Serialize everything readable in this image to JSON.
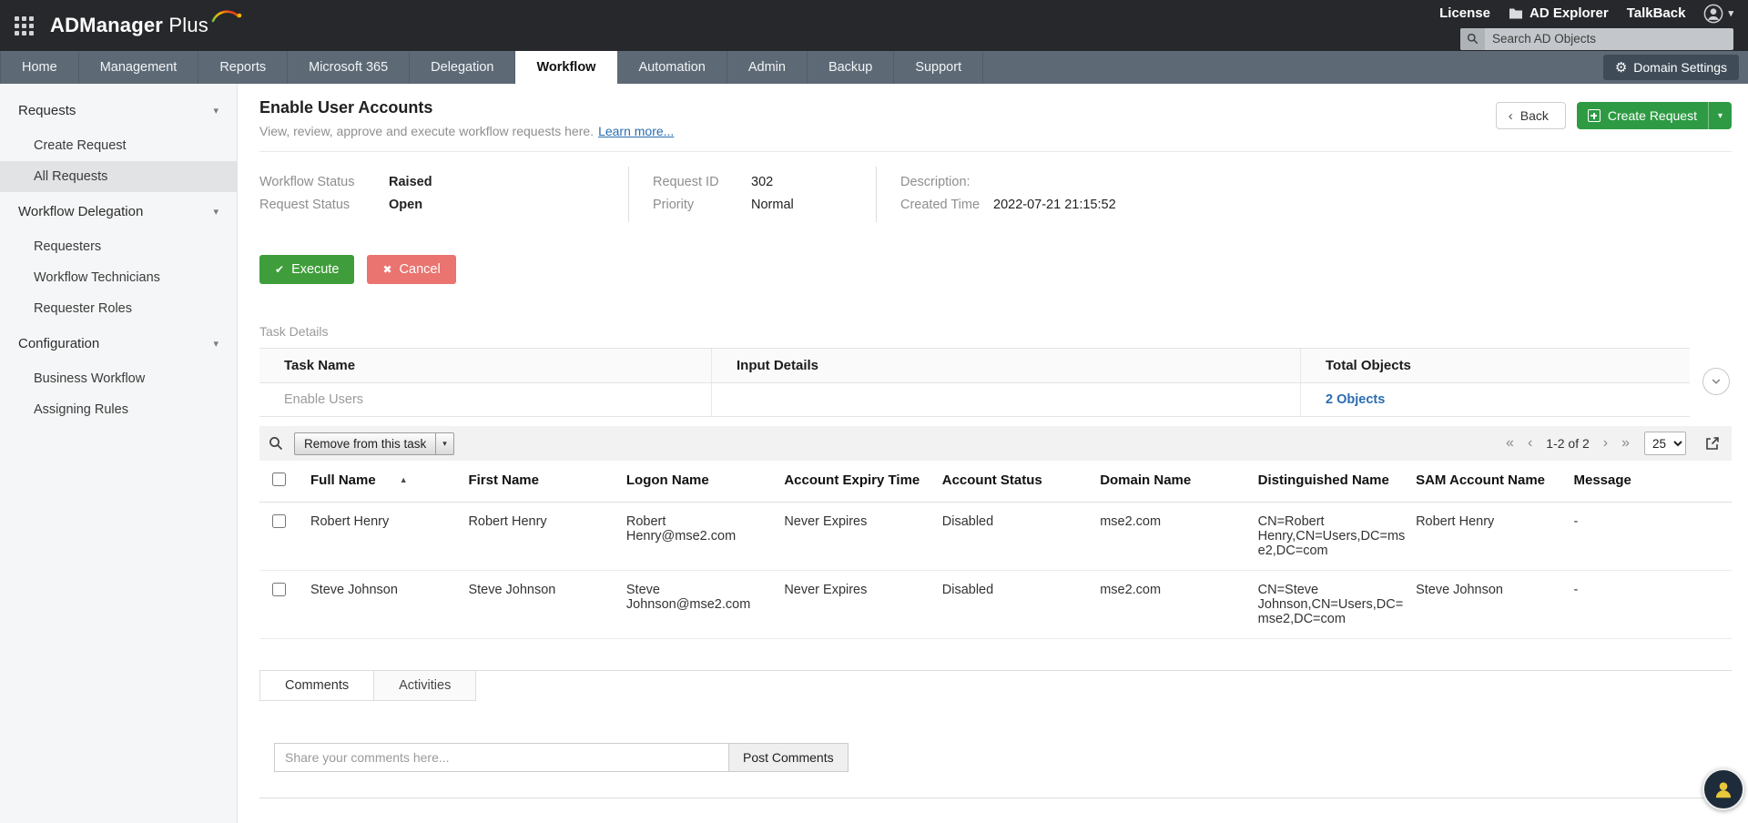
{
  "topbar": {
    "logo_primary": "ADManager",
    "logo_secondary": "Plus",
    "license": "License",
    "ad_explorer": "AD Explorer",
    "talkback": "TalkBack",
    "search_placeholder": "Search AD Objects"
  },
  "nav": {
    "tabs": [
      "Home",
      "Management",
      "Reports",
      "Microsoft 365",
      "Delegation",
      "Workflow",
      "Automation",
      "Admin",
      "Backup",
      "Support"
    ],
    "active_tab": "Workflow",
    "domain_settings_label": "Domain Settings"
  },
  "sidebar": {
    "sections": [
      {
        "label": "Requests",
        "items": [
          "Create Request",
          "All Requests"
        ]
      },
      {
        "label": "Workflow Delegation",
        "items": [
          "Requesters",
          "Workflow Technicians",
          "Requester Roles"
        ]
      },
      {
        "label": "Configuration",
        "items": [
          "Business Workflow",
          "Assigning Rules"
        ]
      }
    ],
    "selected_item": "All Requests"
  },
  "page": {
    "title": "Enable User Accounts",
    "subtitle": "View, review, approve and execute workflow requests here.",
    "learn_more_label": "Learn more...",
    "back_label": "Back",
    "create_request_label": "Create Request"
  },
  "request_info": {
    "workflow_status_label": "Workflow Status",
    "workflow_status_value": "Raised",
    "request_status_label": "Request Status",
    "request_status_value": "Open",
    "request_id_label": "Request ID",
    "request_id_value": "302",
    "priority_label": "Priority",
    "priority_value": "Normal",
    "description_label": "Description:",
    "created_time_label": "Created Time",
    "created_time_value": "2022-07-21 21:15:52"
  },
  "actions": {
    "execute_label": "Execute",
    "cancel_label": "Cancel"
  },
  "task_details": {
    "section_label": "Task Details",
    "col_task_name": "Task Name",
    "col_input_details": "Input Details",
    "col_total_objects": "Total Objects",
    "task_name_value": "Enable Users",
    "total_objects_value": "2 Objects"
  },
  "grid_toolbar": {
    "remove_button_label": "Remove from this task",
    "page_info": "1-2 of 2",
    "page_size": "25"
  },
  "table": {
    "columns": [
      "Full Name",
      "First Name",
      "Logon Name",
      "Account Expiry Time",
      "Account Status",
      "Domain Name",
      "Distinguished Name",
      "SAM Account Name",
      "Message"
    ],
    "sorted_by": "Full Name",
    "sort_direction": "ascending",
    "rows": [
      {
        "cells": [
          "Robert Henry",
          "Robert Henry",
          "Robert Henry@mse2.com",
          "Never Expires",
          "Disabled",
          "mse2.com",
          "CN=Robert Henry,CN=Users,DC=mse2,DC=com",
          "Robert Henry",
          "-"
        ]
      },
      {
        "cells": [
          "Steve Johnson",
          "Steve Johnson",
          "Steve Johnson@mse2.com",
          "Never Expires",
          "Disabled",
          "mse2.com",
          "CN=Steve Johnson,CN=Users,DC=mse2,DC=com",
          "Steve Johnson",
          "-"
        ]
      }
    ]
  },
  "comments": {
    "tab_comments": "Comments",
    "tab_activities": "Activities",
    "active_tab": "Comments",
    "input_placeholder": "Share your comments here...",
    "post_button_label": "Post Comments"
  },
  "icons": {
    "caret_down": "▾",
    "sort_asc": "▲",
    "check": "✔",
    "cross": "✖",
    "gear": "⚙",
    "back_chevron": "‹",
    "pagination_first": "«",
    "pagination_prev": "‹",
    "pagination_next": "›",
    "pagination_last": "»"
  },
  "colors": {
    "topbar": "#26282b",
    "navbar": "#5d6a76",
    "accent_green": "#2e9b44",
    "execute_green": "#3f9e3b",
    "cancel_red": "#e97470",
    "link_blue": "#2b6cb0"
  }
}
